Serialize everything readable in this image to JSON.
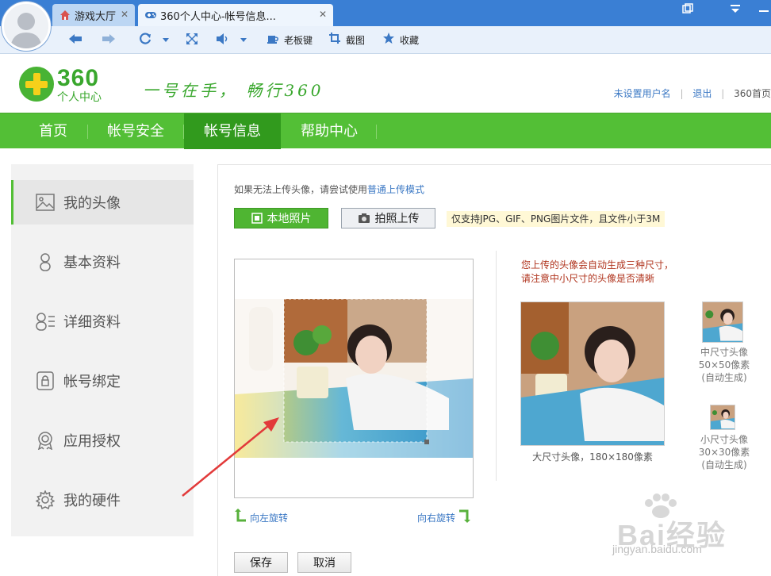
{
  "browser": {
    "tabs": [
      {
        "label": "游戏大厅",
        "close": "✕"
      },
      {
        "label": "360个人中心-帐号信息...",
        "close": "✕"
      }
    ],
    "toolbar": {
      "boss_key": "老板键",
      "screenshot": "截图",
      "favorites": "收藏"
    }
  },
  "header": {
    "logo_number": "360",
    "logo_sub": "个人中心",
    "slogan": "一号在手，  畅行360",
    "user_link": "未设置用户名",
    "logout": "退出",
    "home_link": "360首页"
  },
  "nav": {
    "items": [
      "首页",
      "帐号安全",
      "帐号信息",
      "帮助中心"
    ],
    "active": "帐号信息"
  },
  "sidebar": {
    "items": [
      "我的头像",
      "基本资料",
      "详细资料",
      "帐号绑定",
      "应用授权",
      "我的硬件"
    ]
  },
  "main": {
    "hint_prefix": "如果无法上传头像，请尝试使用",
    "hint_link": "普通上传模式",
    "btn_local": "本地照片",
    "btn_photo": "拍照上传",
    "support_note": "仅支持JPG、GIF、PNG图片文件，且文件小于3M",
    "gen_note_line1": "您上传的头像会自动生成三种尺寸，",
    "gen_note_line2": "请注意中小尺寸的头像是否清晰",
    "large_caption": "大尺寸头像，180×180像素",
    "mid_caption_1": "中尺寸头像",
    "mid_caption_2": "50×50像素",
    "mid_caption_3": "(自动生成)",
    "small_caption_1": "小尺寸头像",
    "small_caption_2": "30×30像素",
    "small_caption_3": "(自动生成)",
    "rotate_left": "向左旋转",
    "rotate_right": "向右旋转",
    "save": "保存",
    "cancel": "取消"
  },
  "watermark": {
    "text": "Bai经验",
    "sub": "jingyan.baidu.com"
  },
  "colors": {
    "brand_green": "#53bf36",
    "nav_active": "#319a1d",
    "link_blue": "#3b78c4",
    "browser_blue": "#3a7fd4",
    "annotation_red": "#e23a3a"
  }
}
